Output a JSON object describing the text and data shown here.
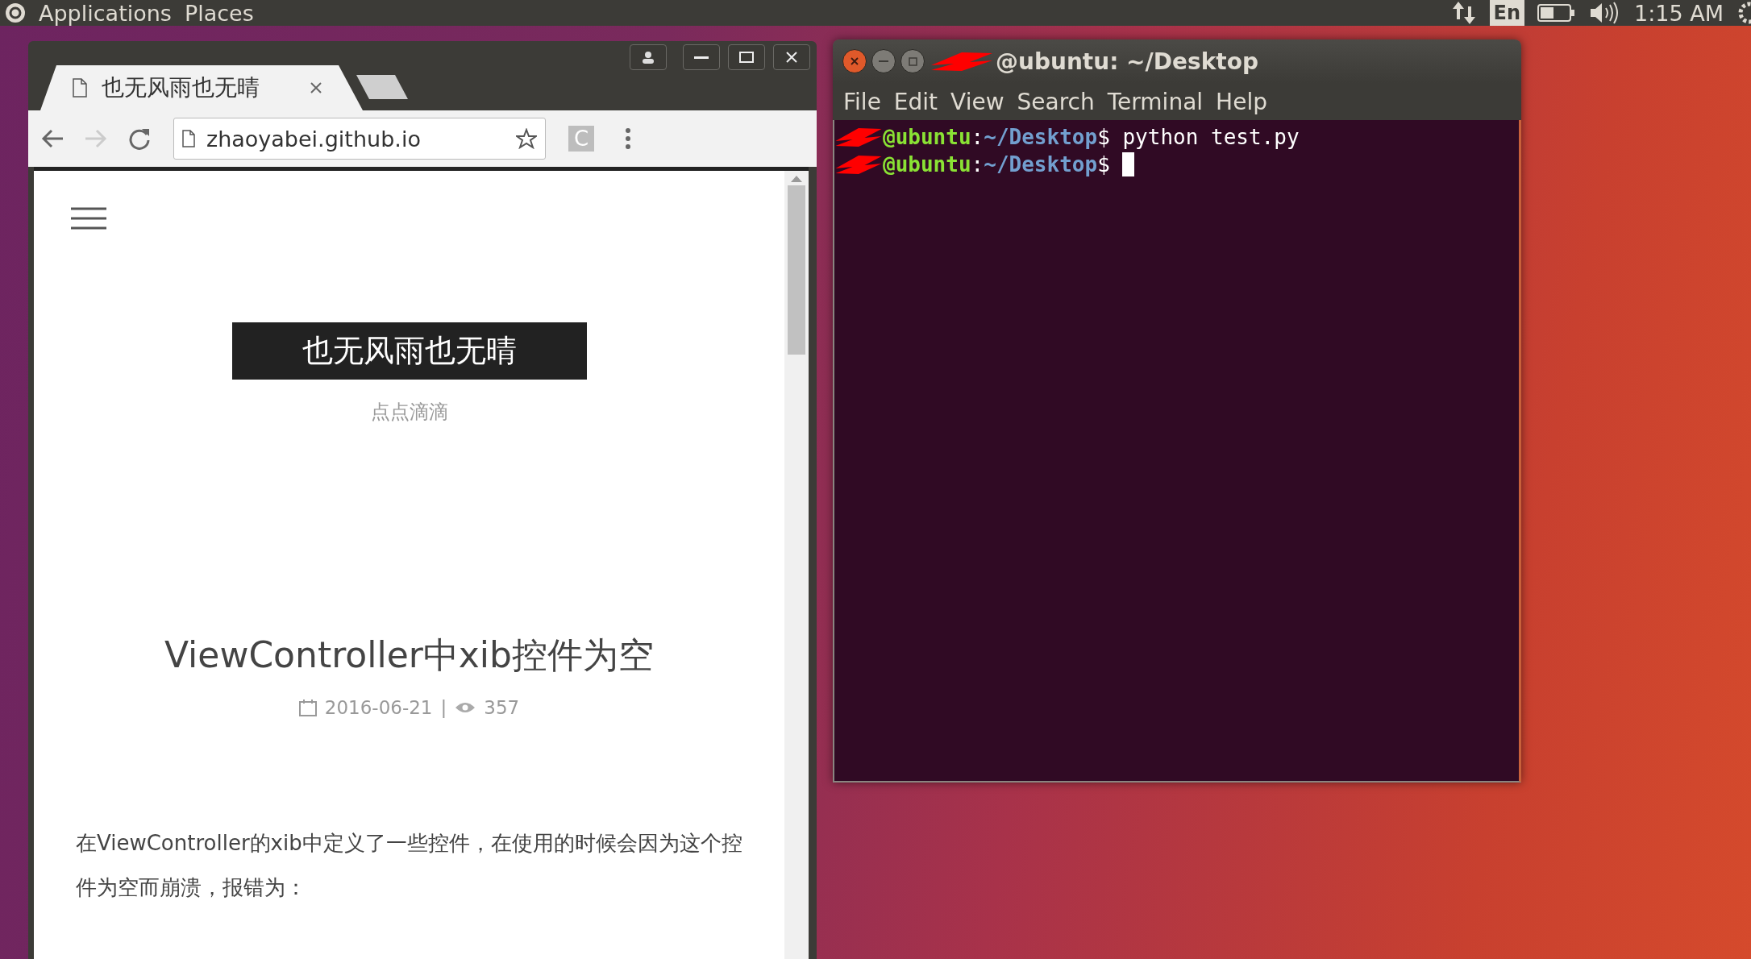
{
  "top_panel": {
    "menus": [
      "Applications",
      "Places"
    ],
    "keyboard_layout": "En",
    "clock": "1:15 AM"
  },
  "browser": {
    "tabs": [
      {
        "title": "也无风雨也无晴",
        "selected": true
      }
    ],
    "toolbar": {
      "forward_disabled": true,
      "url": "zhaoyabei.github.io",
      "extension_label": "C"
    },
    "page": {
      "site_title": "也无风雨也无晴",
      "site_subtitle": "点点滴滴",
      "post_title": "ViewController中xib控件为空",
      "date": "2016-06-21",
      "separator": "|",
      "views": "357",
      "paragraph": "在ViewController的xib中定义了一些控件，在使用的时候会因为这个控件为空而崩溃，报错为："
    }
  },
  "terminal": {
    "title": "@ubuntu: ~/Desktop",
    "menu": [
      "File",
      "Edit",
      "View",
      "Search",
      "Terminal",
      "Help"
    ],
    "lines": [
      {
        "host": "@ubuntu",
        "colon": ":",
        "path": "~/Desktop",
        "symbol": "$",
        "command": "python test.py",
        "cursor": false
      },
      {
        "host": "@ubuntu",
        "colon": ":",
        "path": "~/Desktop",
        "symbol": "$",
        "cursor": true
      }
    ]
  }
}
